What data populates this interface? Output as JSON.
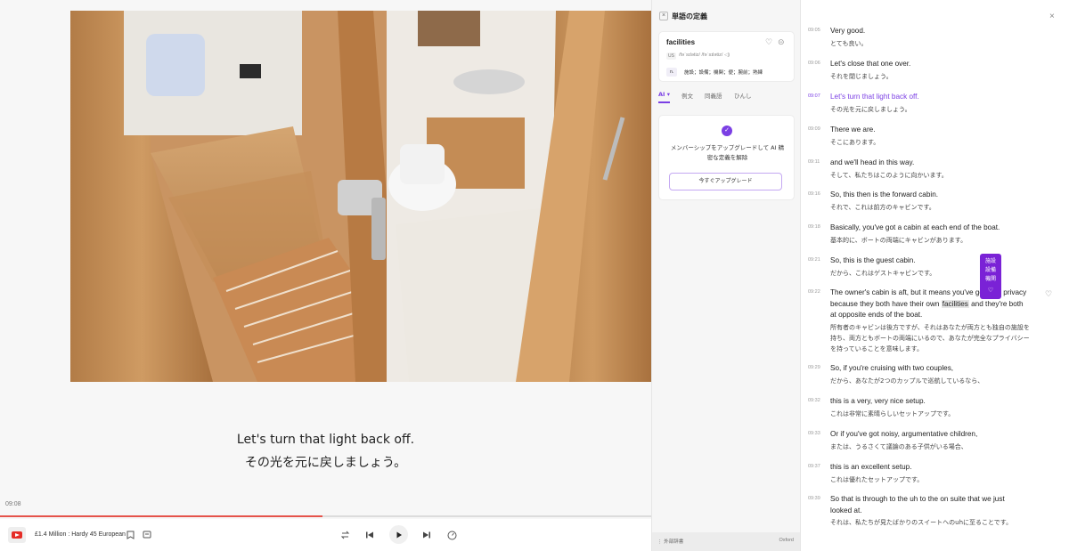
{
  "player": {
    "subtitle_en": "Let's turn that light back off.",
    "subtitle_ja": "その光を元に戻しましょう。",
    "current_time": "09:08",
    "progress": 0.495,
    "video_title": "£1.4 Million : Hardy 45 European",
    "icons": [
      "youtube-icon",
      "bookmark-icon",
      "captions-icon",
      "loop-icon",
      "skip-back-icon",
      "play-icon",
      "skip-forward-icon",
      "speed-icon"
    ]
  },
  "dict": {
    "title": "単語の定義",
    "word": "facilities",
    "region": "US",
    "ipa": "/fəˈsɪlətiz/ /fəˈsɪlətiz/ ◁)",
    "pos": "n.",
    "meaning": "施設；設備；機関；便；腕前；熟練",
    "tabs": [
      "AI ▾",
      "例文",
      "同義語",
      "ひんし"
    ],
    "upgrade_text": "メンバーシップをアップグレードして AI 精密な定義を解除",
    "upgrade_button": "今すぐアップグレード",
    "footer_left": "⋮ 外部辞書",
    "footer_right": "Oxford",
    "accent": "#7b3fe4"
  },
  "transcript": {
    "lines": [
      {
        "time": "09:05",
        "en": "Very good.",
        "ja": "とても良い。"
      },
      {
        "time": "09:06",
        "en": "Let's close that one over.",
        "ja": "それを閉じましょう。"
      },
      {
        "time": "09:07",
        "en": "Let's turn that light back off.",
        "ja": "その光を元に戻しましょう。"
      },
      {
        "time": "09:09",
        "en": "There we are.",
        "ja": "そこにあります。"
      },
      {
        "time": "09:11",
        "en": "and we'll head in this way.",
        "ja": "そして、私たちはこのように向かいます。"
      },
      {
        "time": "09:16",
        "en": "So, this then is the forward cabin.",
        "ja": "それで、これは前方のキャビンです。"
      },
      {
        "time": "09:18",
        "en": "Basically, you've got a cabin at each end of the boat.",
        "ja": "基本的に、ボートの両端にキャビンがあります。"
      },
      {
        "time": "09:21",
        "en": "So, this is the guest cabin.",
        "ja": "だから、これはゲストキャビンです。"
      },
      {
        "time": "09:22",
        "en_a": "The owner's cabin is aft, but it means you've got total privacy because they both have their own ",
        "en_hl": "facilities",
        "en_b": " and they're both at opposite ends of the boat.",
        "ja": "所有者のキャビンは後方ですが、それはあなたが両方とも独自の施設を持ち、両方ともボートの両端にいるので、あなたが完全なプライバシーを持っていることを意味します。"
      },
      {
        "time": "09:29",
        "en": "So, if you're cruising with two couples,",
        "ja": "だから、あなたが2つのカップルで巡航しているなら、"
      },
      {
        "time": "09:32",
        "en": "this is a very, very nice setup.",
        "ja": "これは非常に素晴らしいセットアップです。"
      },
      {
        "time": "09:33",
        "en": "Or if you've got noisy, argumentative children,",
        "ja": "または、うるさくて議論のある子供がいる場合、"
      },
      {
        "time": "09:37",
        "en": "this is an excellent setup.",
        "ja": "これは優れたセットアップです。"
      },
      {
        "time": "09:39",
        "en": "So that is through to the uh to the on suite that we just looked at.",
        "ja": "それは、私たちが見たばかりのスイートへのuhに至ることです。"
      }
    ],
    "popup_values": [
      "施設",
      "設備",
      "機関"
    ]
  }
}
